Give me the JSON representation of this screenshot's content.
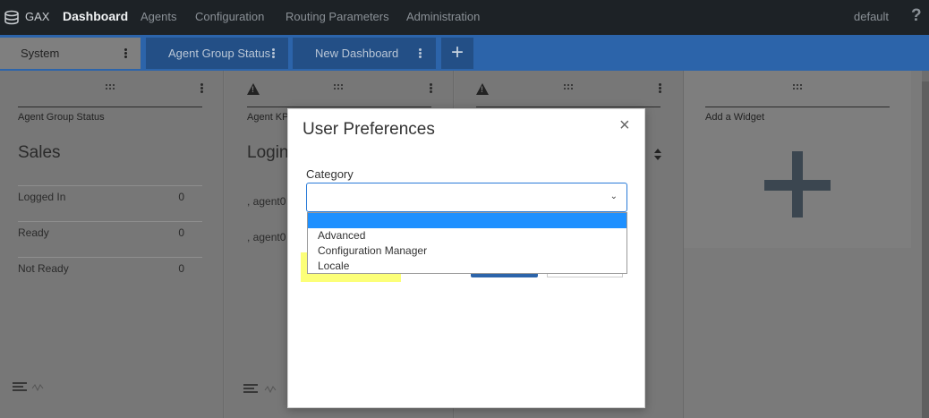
{
  "nav": {
    "app_name": "GAX",
    "items": [
      {
        "label": "Dashboard",
        "active": true
      },
      {
        "label": "Agents"
      },
      {
        "label": "Configuration"
      },
      {
        "label": "Routing Parameters"
      },
      {
        "label": "Administration"
      }
    ],
    "user": "default",
    "help": "?"
  },
  "tabs": [
    {
      "label": "System"
    },
    {
      "label": "Agent Group Status"
    },
    {
      "label": "New Dashboard"
    }
  ],
  "add_tab": "+",
  "widgets": {
    "w1": {
      "title": "Agent Group Status",
      "big": "Sales",
      "rows": [
        {
          "label": "Logged In",
          "value": "0"
        },
        {
          "label": "Ready",
          "value": "0"
        },
        {
          "label": "Not Ready",
          "value": "0"
        }
      ]
    },
    "w2": {
      "title": "Agent KP",
      "big": "Login",
      "rows": [
        ", agent0",
        ", agent0"
      ]
    },
    "w4": {
      "title": "Add a Widget"
    }
  },
  "modal": {
    "title": "User Preferences",
    "close": "×",
    "field_label": "Category",
    "chevron": "⌄",
    "options": [
      "",
      "Advanced",
      "Configuration Manager",
      "Locale"
    ]
  },
  "colors": {
    "accent": "#2c64aa",
    "highlight": "#fbff60",
    "selection": "#1e90ff"
  }
}
